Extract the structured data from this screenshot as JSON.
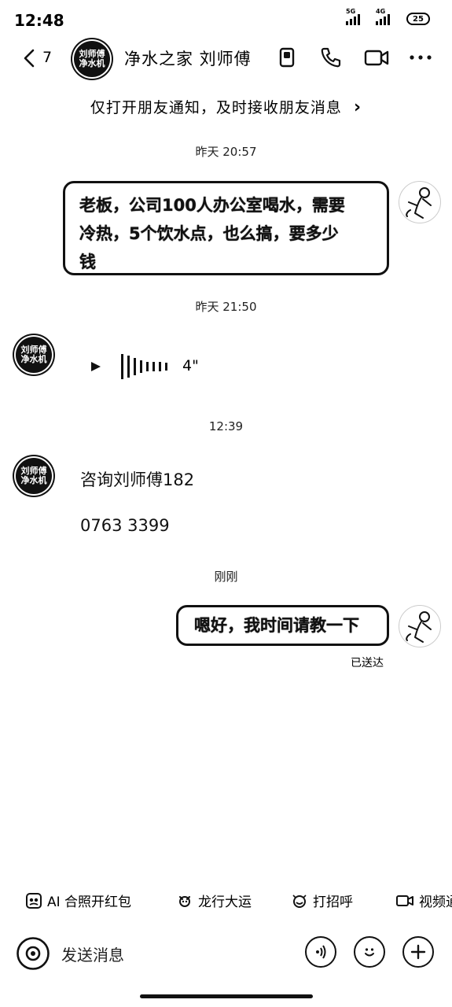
{
  "status_bar": {
    "time": "12:48",
    "net1": "5G",
    "net2": "4G",
    "battery": "25"
  },
  "header": {
    "back_count": "7",
    "avatar_text": [
      "刘师傅",
      "净水机"
    ],
    "title": "净水之家 刘师傅"
  },
  "notice": {
    "text": "仅打开朋友通知，及时接收朋友消息",
    "arrow": "›"
  },
  "messages": [
    {
      "time": "昨天 20:57",
      "side": "right",
      "type": "text",
      "text_lines": [
        "老板，公司100人办公室喝水，需要",
        "冷热，5个饮水点，也么搞，要多少",
        "钱"
      ]
    },
    {
      "time": "昨天 21:50",
      "side": "left",
      "type": "voice",
      "duration": "4\""
    },
    {
      "time": "12:39",
      "side": "left",
      "type": "text",
      "text_lines": [
        "咨询刘师傅182",
        "0763 3399"
      ]
    },
    {
      "time": "刚刚",
      "side": "right",
      "type": "text",
      "text": "嗯好，我时间请教一下",
      "status": "已送达"
    }
  ],
  "quick_actions": [
    {
      "label": "AI 合照开红包",
      "icon": "ai-photo-icon"
    },
    {
      "label": "龙行大运",
      "icon": "dragon-icon"
    },
    {
      "label": "打招呼",
      "icon": "wave-icon"
    },
    {
      "label": "视频通话",
      "icon": "video-icon"
    }
  ],
  "input": {
    "placeholder": "发送消息"
  }
}
